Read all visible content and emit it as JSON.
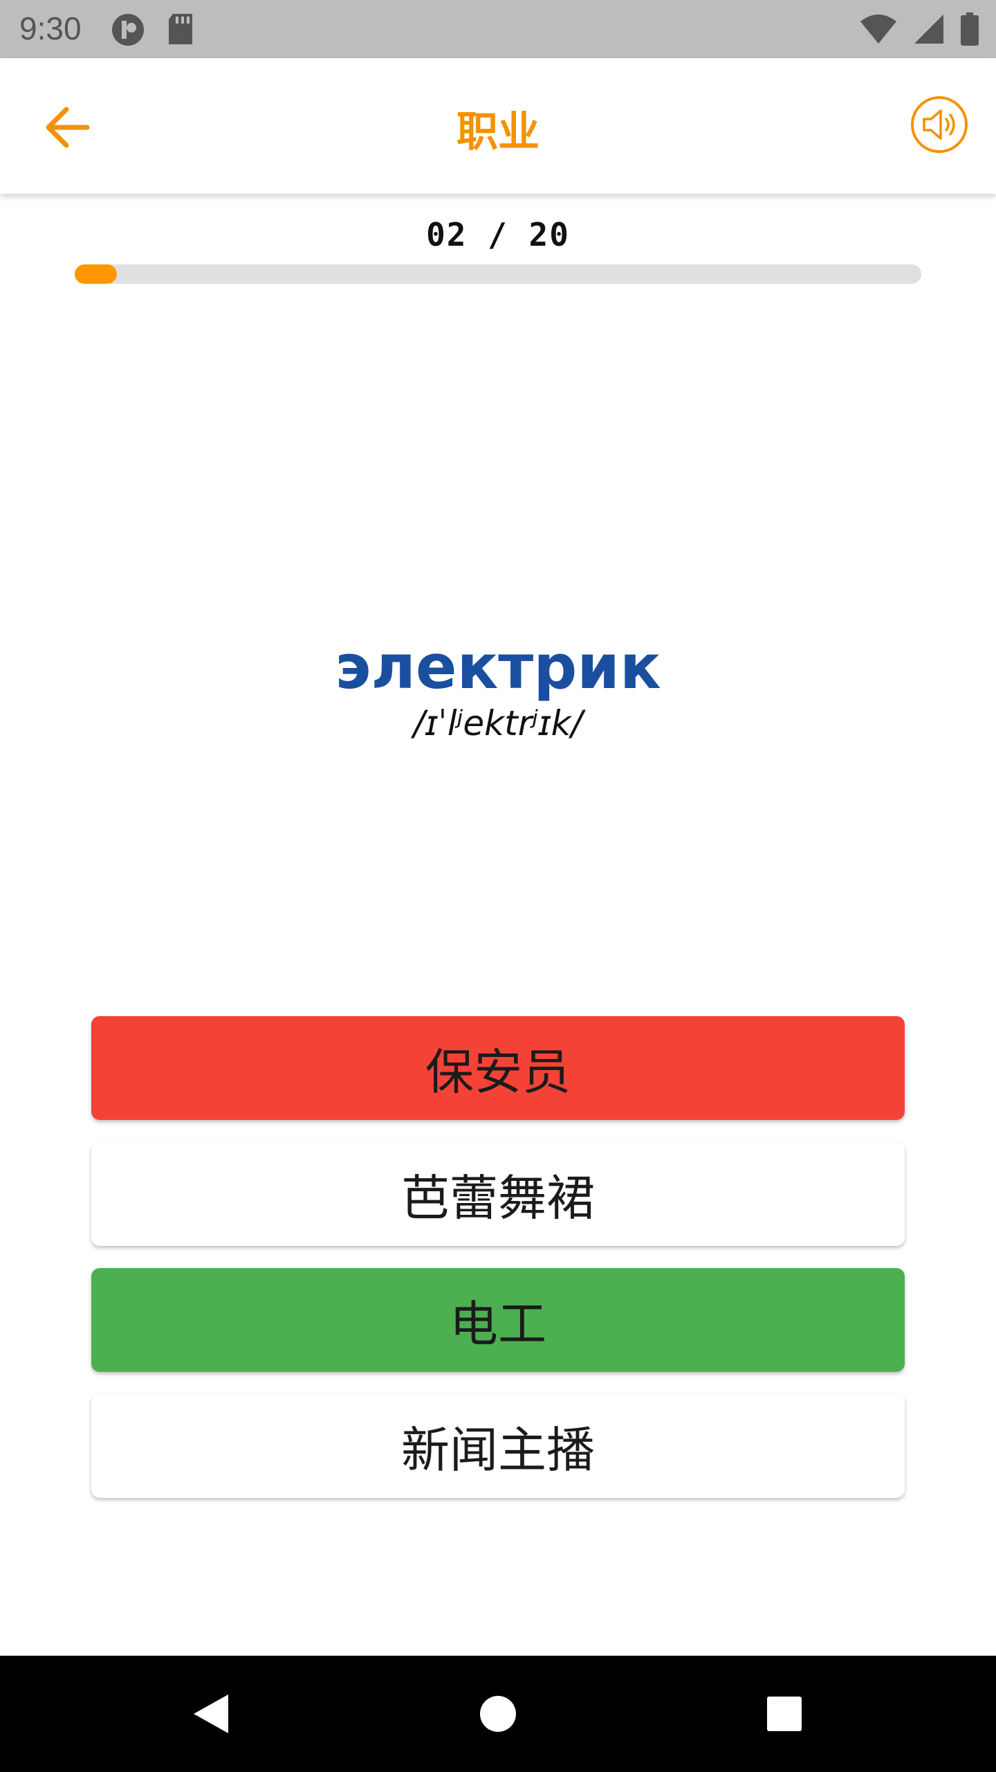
{
  "status_bar": {
    "time": "9:30"
  },
  "app_bar": {
    "title": "职业",
    "back_icon": "arrow-left-icon",
    "sound_icon": "speaker-icon"
  },
  "progress": {
    "label": "02 / 20",
    "current": 2,
    "total": 20,
    "fraction": 0.05
  },
  "word": {
    "text": "электрик",
    "phonetic": "/ɪˈlʲektrʲɪk/"
  },
  "options": [
    {
      "label": "保安员",
      "state": "wrong"
    },
    {
      "label": "芭蕾舞裙",
      "state": "neutral"
    },
    {
      "label": "电工",
      "state": "correct"
    },
    {
      "label": "新闻主播",
      "state": "neutral"
    }
  ],
  "colors": {
    "accent": "#f39200",
    "progress_fill": "#ff9800",
    "word": "#1a4fa0",
    "wrong": "#f44336",
    "correct": "#4caf50"
  }
}
